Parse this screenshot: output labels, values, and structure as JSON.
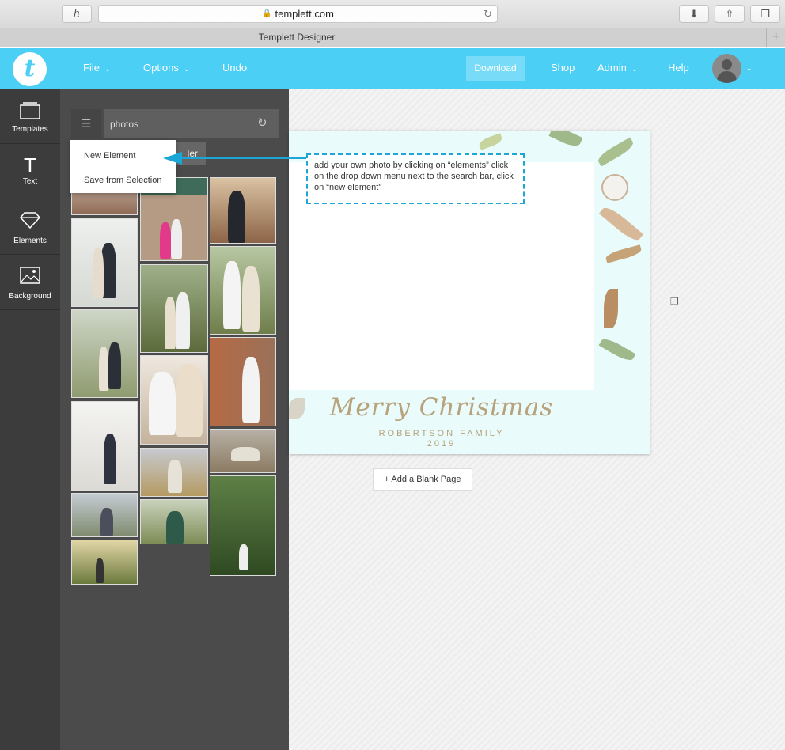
{
  "browser": {
    "url": "templett.com",
    "tab_title": "Templett Designer",
    "left_button_glyph": "h",
    "icons": [
      "lock-icon",
      "reload-icon",
      "download-icon",
      "share-icon",
      "tabs-icon",
      "new-tab-plus-icon"
    ]
  },
  "nav": {
    "logo_letter": "t",
    "file": "File",
    "options": "Options",
    "undo": "Undo",
    "download": "Download",
    "shop": "Shop",
    "admin": "Admin",
    "help": "Help",
    "accent": "#4ccff5"
  },
  "rail": {
    "items": [
      {
        "label": "Templates",
        "icon": "templates-icon"
      },
      {
        "label": "Text",
        "icon": "text-icon"
      },
      {
        "label": "Elements",
        "icon": "diamond-icon"
      },
      {
        "label": "Background",
        "icon": "image-icon"
      }
    ]
  },
  "panel": {
    "search_value": "photos",
    "upload_partial": "ler",
    "dropdown": [
      "New Element",
      "Save from Selection"
    ]
  },
  "annotation": {
    "text": "add your own photo by clicking on “elements” click on the drop down menu next to the search bar, click on “new element”",
    "color": "#1ba6d6"
  },
  "card": {
    "title": "Merry Christmas",
    "family": "ROBERTSON FAMILY",
    "year": "2019"
  },
  "add_page": "+ Add a Blank Page"
}
